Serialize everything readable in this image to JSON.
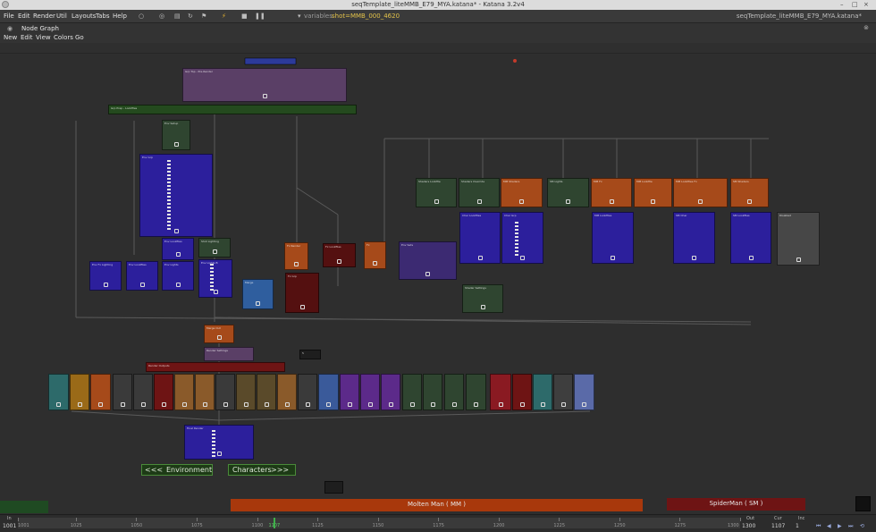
{
  "window": {
    "title": "seqTemplate_liteMMB_E79_MYA.katana* - Katana 3.2v4",
    "right_title": "seqTemplate_liteMMB_E79_MYA.katana*",
    "controls": [
      "–",
      "□",
      "×"
    ]
  },
  "menubar": {
    "items": [
      "File",
      "Edit",
      "Render",
      "Util",
      "Layouts",
      "Tabs",
      "Help"
    ],
    "variables_label": "variables",
    "shot_value": "shot=MMB_000_4620"
  },
  "panel": {
    "title": "Node Graph",
    "menu": [
      "New",
      "Edit",
      "View",
      "Colors",
      "Go"
    ]
  },
  "graph": {
    "nav_left": {
      "arrows": "<<<",
      "label": "Environment"
    },
    "nav_right": {
      "label": "Characters",
      "arrows": ">>>"
    },
    "backdrop_molten": "Molten Man  ( MM )",
    "backdrop_spider": "SpiderMan  ( SM )",
    "colors": {
      "purple": "#2c1f9c",
      "green": "#244a1e",
      "orange": "#a64a1a",
      "red": "#6e1414",
      "grey": "#474747",
      "blue": "#2f5e9e"
    }
  },
  "timeline": {
    "in_label": "In",
    "in_value": "1001",
    "out_label": "Out",
    "out_value": "1300",
    "cur_label": "Cur",
    "cur_value": "1107",
    "inc_label": "Inc",
    "inc_value": "1",
    "current_frame": 1107,
    "ticks": [
      "1001",
      "1025",
      "1050",
      "1075",
      "1100",
      "1107",
      "1125",
      "1150",
      "1175",
      "1200",
      "1225",
      "1250",
      "1275",
      "1300"
    ]
  }
}
